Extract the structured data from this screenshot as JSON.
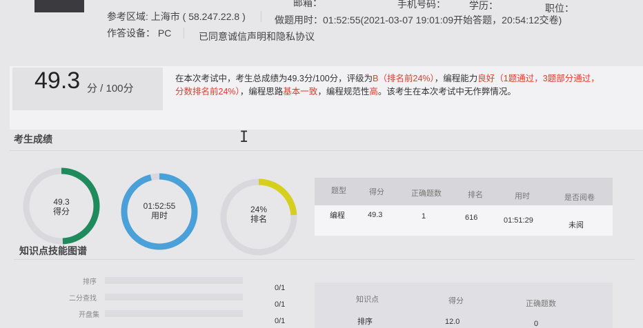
{
  "header": {
    "top_labels": [
      "邮箱：",
      "手机号码：",
      "学历：",
      "职位："
    ],
    "region_label": "参考区域: 上海市 ( 58.247.22.8 )",
    "time_label": "做题用时：01:52:55(2021-03-07 19:01:09开始答题，20:54:12交卷)",
    "device_label": "作答设备： PC",
    "agreement": "已同意诚信声明和隐私协议"
  },
  "score": {
    "value": "49.3",
    "suffix": "分 / 100分"
  },
  "summary": {
    "p1": "在本次考试中，考生总成绩为49.3分/100分，评级为",
    "grade": "B（排名前24%）",
    "p2": "，编程能力",
    "ability": "良好（1题通过，3题部分通过，分数排名前24%）",
    "p3": "，编程思路",
    "thinking": "基本一致",
    "p4": "，编程规范性",
    "norm": "高",
    "p5": "。该考生在本次考试中无作弊情况。"
  },
  "section": {
    "score_title": "考生成绩",
    "skills_title": "知识点技能图谱"
  },
  "gauges": [
    {
      "value": "49.3",
      "label": "得分",
      "color": "#1f8a5b",
      "fraction": 0.493
    },
    {
      "value": "01:52:55",
      "label": "用时",
      "color": "#4aa0d8",
      "fraction": 0.96
    },
    {
      "value": "24%",
      "label": "排名",
      "color": "#d6cf1e",
      "fraction": 0.24
    }
  ],
  "result_table": {
    "headers": [
      "题型",
      "得分",
      "正确题数",
      "排名",
      "用时",
      "是否阅卷"
    ],
    "row": [
      "编程",
      "49.3",
      "1",
      "616",
      "01:51:29",
      "未阅"
    ]
  },
  "skills": {
    "rows": [
      {
        "label": "排序",
        "frac": "0/1"
      },
      {
        "label": "二分查找",
        "frac": "0/1"
      },
      {
        "label": "开盘集",
        "frac": "0/1"
      }
    ],
    "table_headers": [
      "知识点",
      "得分",
      "正确题数"
    ],
    "table_row": [
      "排序",
      "12.0",
      "0"
    ]
  }
}
